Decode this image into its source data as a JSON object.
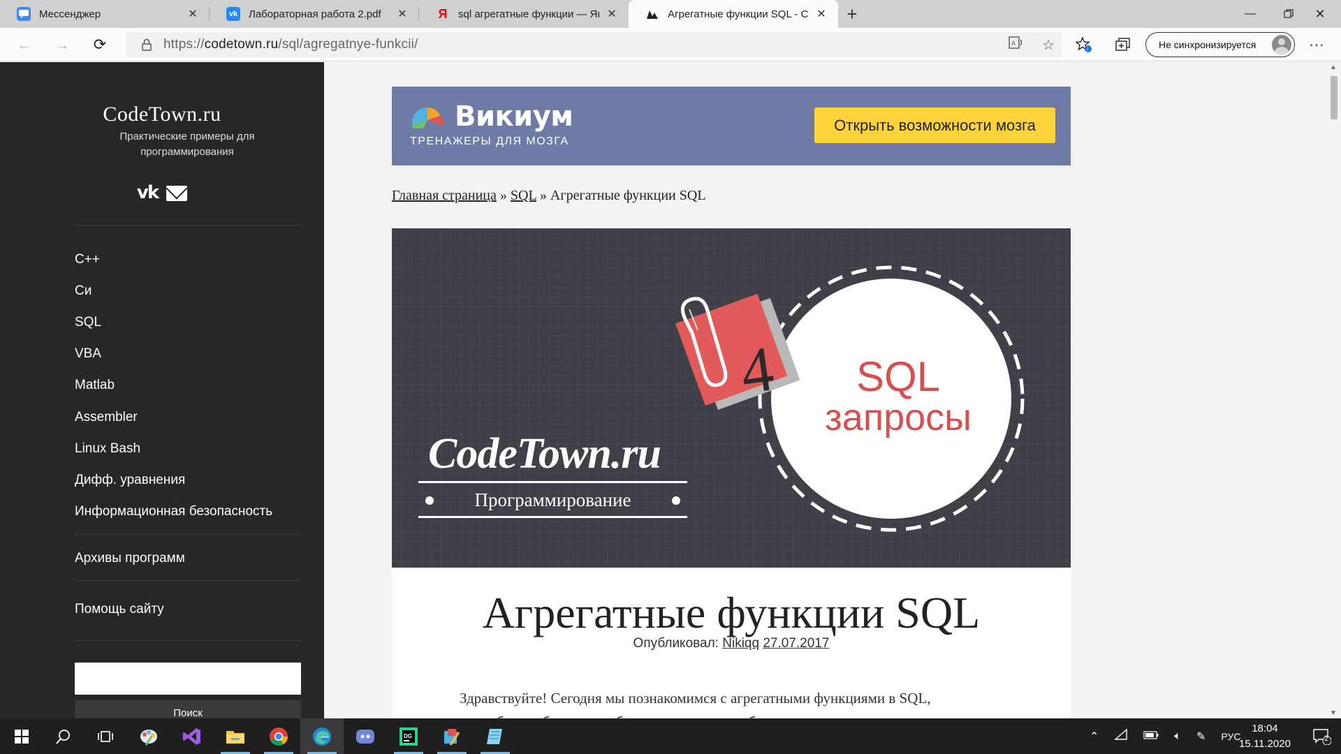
{
  "browser": {
    "tabs": [
      {
        "title": "Мессенджер",
        "favicon_color": "#3d8af7",
        "active": false
      },
      {
        "title": "Лабораторная работа 2.pdf",
        "favicon_color": "#2787f5",
        "active": false
      },
      {
        "title": "sql агрегатные функции — Янде",
        "favicon_color": "#ff0000",
        "favicon_letter": "Я",
        "active": false
      },
      {
        "title": "Агрегатные функции SQL - Cod",
        "favicon_color": "#222222",
        "active": true
      }
    ],
    "address": {
      "url_prefix": "https://",
      "url_host": "codetown.ru",
      "url_path": "/sql/agregatnye-funkcii/"
    },
    "sync_label": "Не синхронизируется"
  },
  "sidebar": {
    "site_name": "CodeTown.ru",
    "tagline": "Практические примеры для программирования",
    "nav": [
      "C++",
      "Си",
      "SQL",
      "VBA",
      "Matlab",
      "Assembler",
      "Linux Bash",
      "Дифф. уравнения",
      "Информационная безопасность"
    ],
    "archives_label": "Архивы программ",
    "help_label": "Помощь сайту",
    "search_button": "Поиск"
  },
  "ad": {
    "brand": "Викиум",
    "subtitle": "ТРЕНАЖЕРЫ ДЛЯ МОЗГА",
    "cta": "Открыть возможности мозга",
    "bg_color": "#6d7ba6",
    "cta_color": "#fcd33b"
  },
  "breadcrumbs": {
    "home": "Главная страница",
    "sep": "»",
    "section": "SQL",
    "current": "Агрегатные функции SQL"
  },
  "hero": {
    "logo_text": "CodeTown.ru",
    "logo_sub": "Программирование",
    "lesson_number": "4",
    "badge_line1": "SQL",
    "badge_line2": "запросы"
  },
  "article": {
    "title": "Агрегатные функции SQL",
    "published_label": "Опубликовал:",
    "author": "Nikiqq",
    "date": "27.07.2017",
    "intro_line1": "Здравствуйте! Сегодня мы познакомимся с агрегатными функциями в SQL,",
    "intro_line2": "подробно разберем их работу с данными из таблиц, которые создавали в"
  },
  "taskbar": {
    "lang": "РУС",
    "time": "18:04",
    "date": "15.11.2020",
    "notifications": "2"
  }
}
